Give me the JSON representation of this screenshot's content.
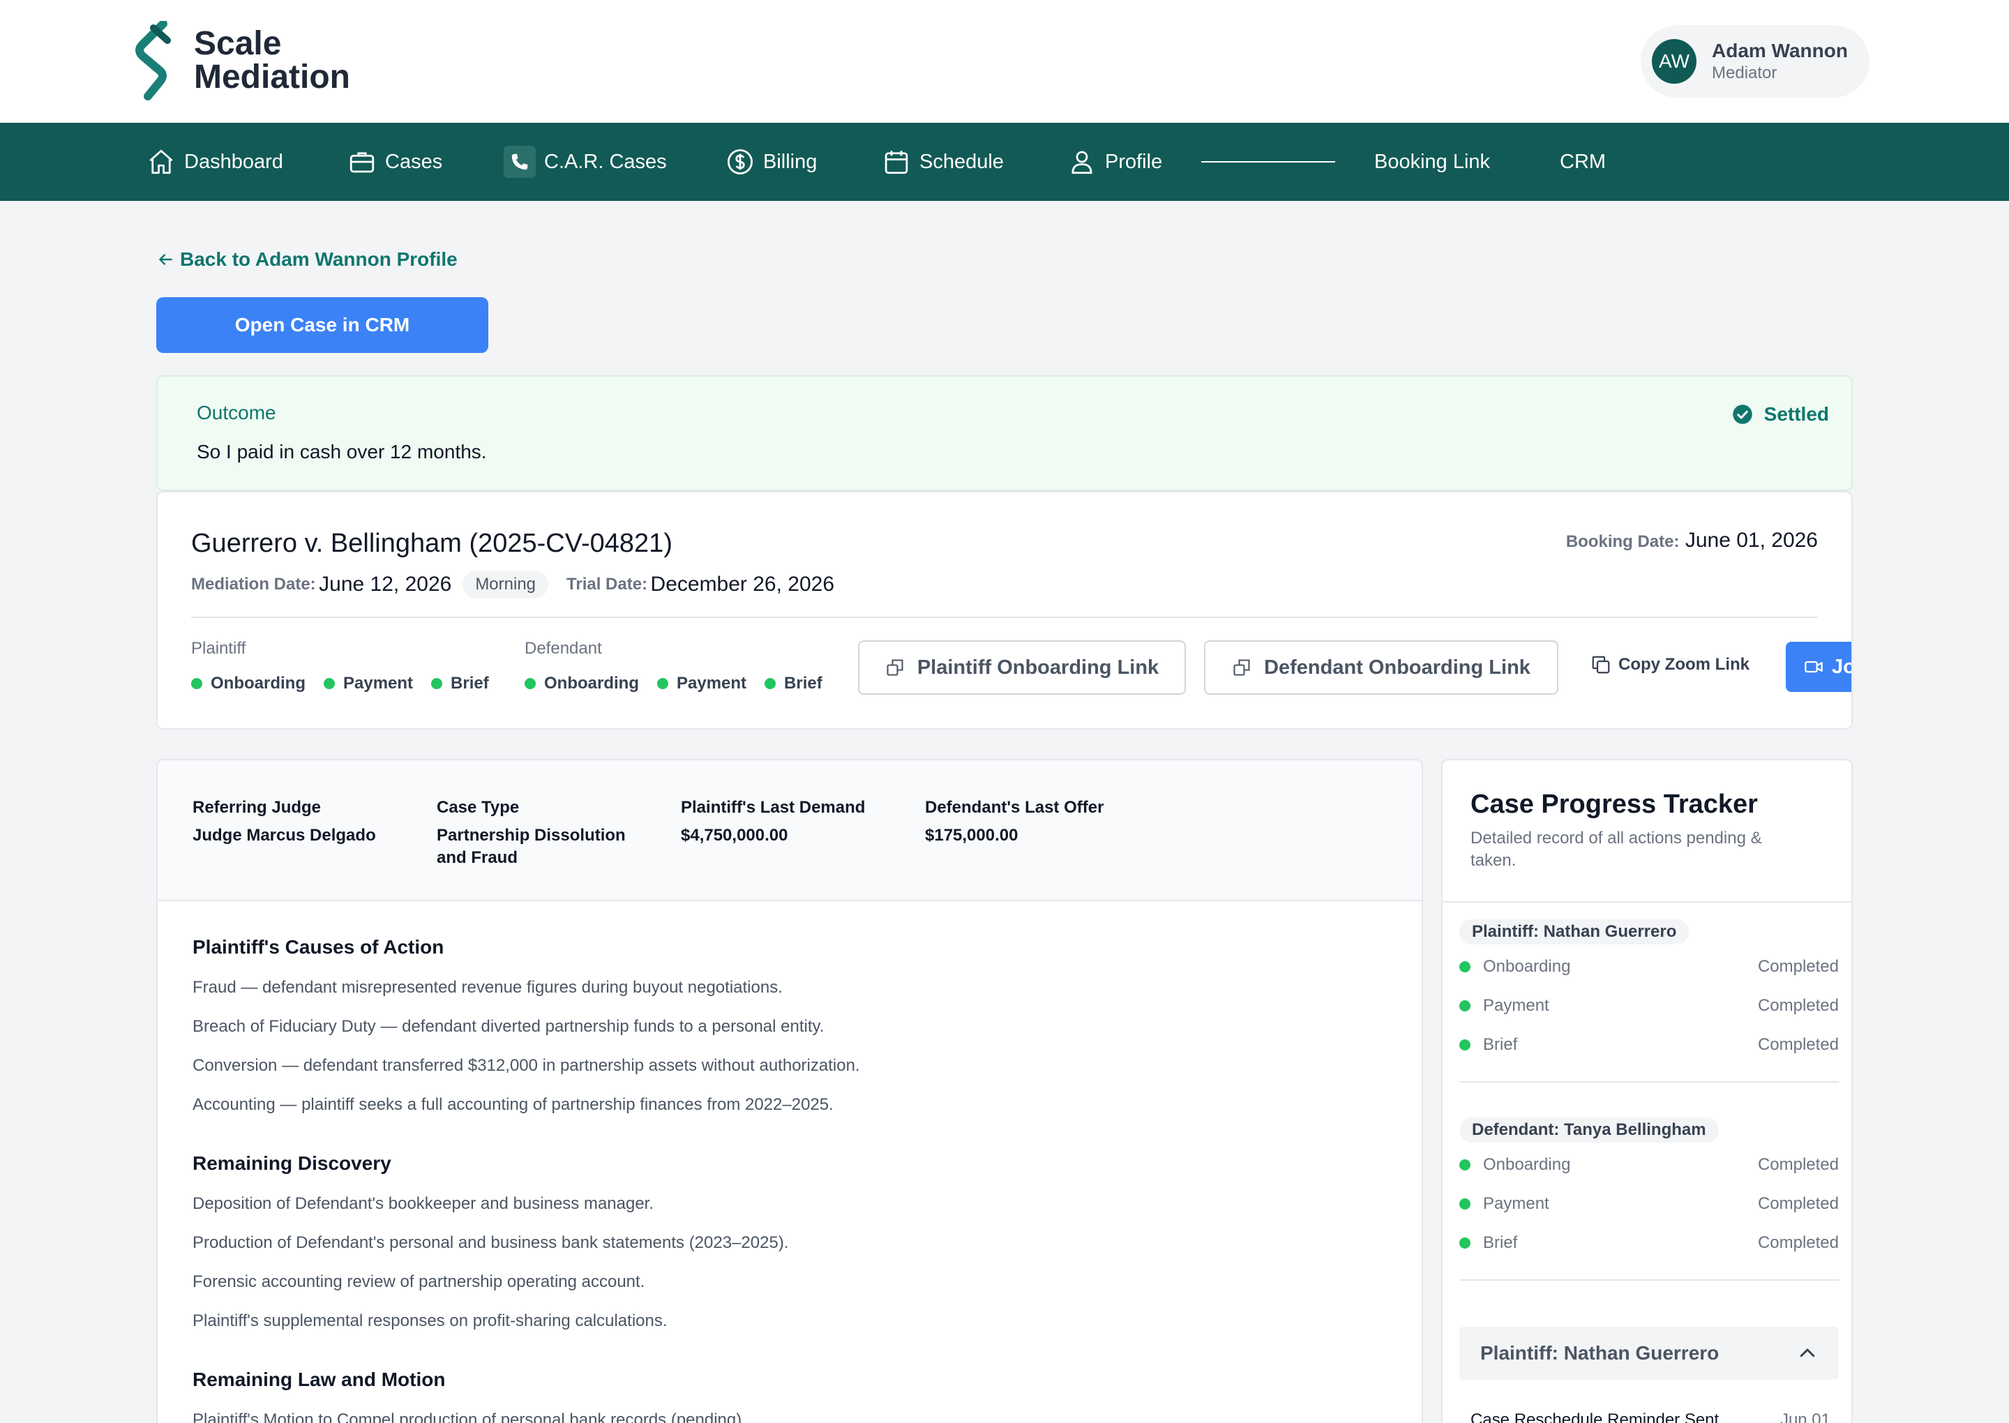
{
  "app": {
    "logo_line1": "Scale",
    "logo_line2": "Mediation",
    "brand_color": "#125a55",
    "accent_color": "#3b82f6"
  },
  "user": {
    "initials": "AW",
    "name": "Adam Wannon",
    "role": "Mediator"
  },
  "nav": {
    "items": [
      {
        "label": "Dashboard",
        "icon": "home-icon"
      },
      {
        "label": "Cases",
        "icon": "briefcase-icon"
      },
      {
        "label": "C.A.R. Cases",
        "icon": "phone-icon"
      },
      {
        "label": "Billing",
        "icon": "dollar-circle-icon"
      },
      {
        "label": "Schedule",
        "icon": "calendar-icon"
      },
      {
        "label": "Profile",
        "icon": "user-icon"
      },
      {
        "label": "Booking Link"
      },
      {
        "label": "CRM"
      }
    ]
  },
  "back_link": "Back to Adam Wannon Profile",
  "open_crm_button": "Open Case in CRM",
  "outcome": {
    "label": "Outcome",
    "text": "So I paid in cash over 12 months.",
    "status": "Settled"
  },
  "case": {
    "title": "Guerrero v. Bellingham (2025-CV-04821)",
    "booking_label": "Booking Date:",
    "booking_date": "June 01, 2026",
    "mediation_label": "Mediation Date:",
    "mediation_date": "June 12, 2026",
    "session": "Morning",
    "trial_label": "Trial Date:",
    "trial_date": "December 26, 2026",
    "plaintiff_label": "Plaintiff",
    "defendant_label": "Defendant",
    "steps": [
      "Onboarding",
      "Payment",
      "Brief"
    ],
    "plaintiff_link_button": "Plaintiff Onboarding Link",
    "defendant_link_button": "Defendant Onboarding Link",
    "copy_zoom": "Copy Zoom Link",
    "breakout_button": "Join Breakout Room"
  },
  "details": {
    "meta": [
      {
        "label": "Referring Judge",
        "value": "Judge Marcus Delgado"
      },
      {
        "label": "Case Type",
        "value": "Partnership Dissolution and Fraud"
      },
      {
        "label": "Plaintiff's Last Demand",
        "value": "$4,750,000.00"
      },
      {
        "label": "Defendant's Last Offer",
        "value": "$175,000.00"
      }
    ],
    "causes": {
      "title": "Plaintiff's Causes of Action",
      "items": [
        "Fraud — defendant misrepresented revenue figures during buyout negotiations.",
        "Breach of Fiduciary Duty — defendant diverted partnership funds to a personal entity.",
        "Conversion — defendant transferred $312,000 in partnership assets without authorization.",
        "Accounting — plaintiff seeks a full accounting of partnership finances from 2022–2025."
      ]
    },
    "discovery": {
      "title": "Remaining Discovery",
      "items": [
        "Deposition of Defendant's bookkeeper and business manager.",
        "Production of Defendant's personal and business bank statements (2023–2025).",
        "Forensic accounting review of partnership operating account.",
        "Plaintiff's supplemental responses on profit-sharing calculations."
      ]
    },
    "law_motion": {
      "title": "Remaining Law and Motion",
      "items": [
        "Plaintiff's Motion to Compel production of personal bank records (pending)."
      ]
    }
  },
  "tracker": {
    "title": "Case Progress Tracker",
    "subtitle": "Detailed record of all actions pending & taken.",
    "groups": [
      {
        "party": "Plaintiff: Nathan Guerrero",
        "rows": [
          {
            "step": "Onboarding",
            "status": "Completed"
          },
          {
            "step": "Payment",
            "status": "Completed"
          },
          {
            "step": "Brief",
            "status": "Completed"
          }
        ]
      },
      {
        "party": "Defendant: Tanya Bellingham",
        "rows": [
          {
            "step": "Onboarding",
            "status": "Completed"
          },
          {
            "step": "Payment",
            "status": "Completed"
          },
          {
            "step": "Brief",
            "status": "Completed"
          }
        ]
      }
    ],
    "accordion_title": "Plaintiff: Nathan Guerrero",
    "log": [
      {
        "event": "Case Reschedule Reminder Sent",
        "date": "Jun 01"
      }
    ]
  }
}
